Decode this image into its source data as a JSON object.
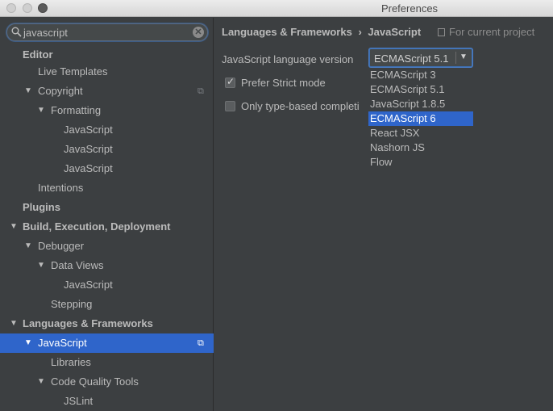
{
  "window": {
    "title": "Preferences"
  },
  "search": {
    "value": "javascript",
    "clear_glyph": "✕",
    "icon": "search-icon"
  },
  "tree": [
    {
      "label": "Editor",
      "depth": 0,
      "bold": true,
      "arrow": "",
      "icon": ""
    },
    {
      "label": "Live Templates",
      "depth": 1,
      "bold": false,
      "arrow": "",
      "icon": ""
    },
    {
      "label": "Copyright",
      "depth": 1,
      "bold": false,
      "arrow": "▼",
      "icon": "⧉"
    },
    {
      "label": "Formatting",
      "depth": 2,
      "bold": false,
      "arrow": "▼",
      "icon": ""
    },
    {
      "label": "JavaScript",
      "depth": 3,
      "bold": false,
      "arrow": "",
      "icon": ""
    },
    {
      "label": "JavaScript",
      "depth": 3,
      "bold": false,
      "arrow": "",
      "icon": ""
    },
    {
      "label": "JavaScript",
      "depth": 3,
      "bold": false,
      "arrow": "",
      "icon": ""
    },
    {
      "label": "Intentions",
      "depth": 1,
      "bold": false,
      "arrow": "",
      "icon": ""
    },
    {
      "label": "Plugins",
      "depth": 0,
      "bold": true,
      "arrow": "",
      "icon": ""
    },
    {
      "label": "Build, Execution, Deployment",
      "depth": 0,
      "bold": true,
      "arrow": "▼",
      "icon": ""
    },
    {
      "label": "Debugger",
      "depth": 1,
      "bold": false,
      "arrow": "▼",
      "icon": ""
    },
    {
      "label": "Data Views",
      "depth": 2,
      "bold": false,
      "arrow": "▼",
      "icon": ""
    },
    {
      "label": "JavaScript",
      "depth": 3,
      "bold": false,
      "arrow": "",
      "icon": ""
    },
    {
      "label": "Stepping",
      "depth": 2,
      "bold": false,
      "arrow": "",
      "icon": ""
    },
    {
      "label": "Languages & Frameworks",
      "depth": 0,
      "bold": true,
      "arrow": "▼",
      "icon": ""
    },
    {
      "label": "JavaScript",
      "depth": 1,
      "bold": false,
      "arrow": "▼",
      "icon": "⧉",
      "selected": true
    },
    {
      "label": "Libraries",
      "depth": 2,
      "bold": false,
      "arrow": "",
      "icon": ""
    },
    {
      "label": "Code Quality Tools",
      "depth": 2,
      "bold": false,
      "arrow": "▼",
      "icon": ""
    },
    {
      "label": "JSLint",
      "depth": 3,
      "bold": false,
      "arrow": "",
      "icon": ""
    }
  ],
  "main": {
    "breadcrumb": {
      "parent": "Languages & Frameworks",
      "separator": "›",
      "current": "JavaScript"
    },
    "scope_label": "For current project",
    "language_version_label": "JavaScript language version",
    "language_version_value": "ECMAScript 5.1",
    "checkboxes": [
      {
        "label": "Prefer Strict mode",
        "checked": true
      },
      {
        "label": "Only type-based completi",
        "checked": false
      }
    ],
    "dropdown_options": [
      {
        "label": "ECMAScript 3",
        "selected": false
      },
      {
        "label": "ECMAScript 5.1",
        "selected": false
      },
      {
        "label": "JavaScript 1.8.5",
        "selected": false
      },
      {
        "label": "ECMAScript 6",
        "selected": true
      },
      {
        "label": "React JSX",
        "selected": false
      },
      {
        "label": "Nashorn JS",
        "selected": false
      },
      {
        "label": "Flow",
        "selected": false
      }
    ]
  },
  "colors": {
    "background": "#3c3f41",
    "selection": "#2f65ca",
    "text": "#bbbbbb"
  }
}
